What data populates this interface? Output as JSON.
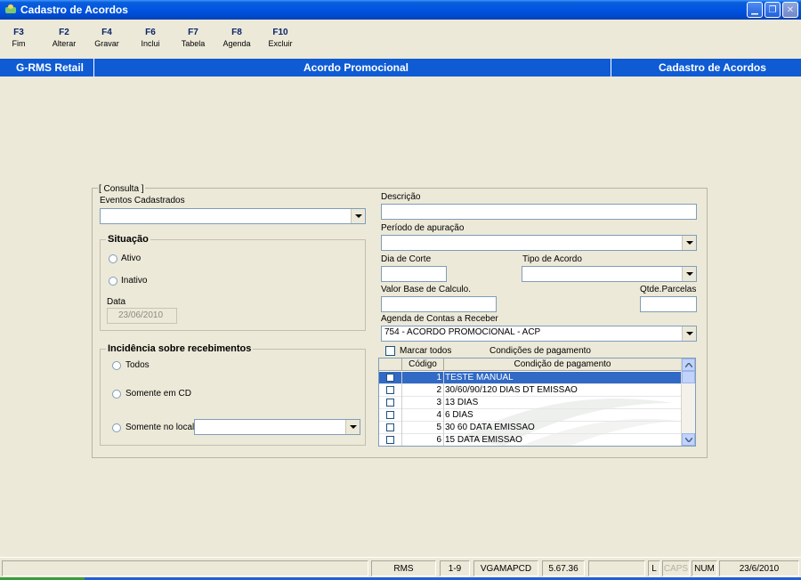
{
  "window": {
    "title": "Cadastro de Acordos"
  },
  "toolbar": {
    "keys": [
      {
        "key": "F3",
        "label": "Fim"
      },
      {
        "key": "F2",
        "label": "Alterar"
      },
      {
        "key": "F4",
        "label": "Gravar"
      },
      {
        "key": "F6",
        "label": "Inclui"
      },
      {
        "key": "F7",
        "label": "Tabela"
      },
      {
        "key": "F8",
        "label": "Agenda"
      },
      {
        "key": "F10",
        "label": "Excluir"
      }
    ]
  },
  "band": {
    "left": "G-RMS Retail",
    "center": "Acordo Promocional",
    "right": "Cadastro de Acordos"
  },
  "form": {
    "consulta_legend": "[ Consulta ]",
    "eventos_label": "Eventos Cadastrados",
    "eventos_value": "",
    "situacao_legend": "Situação",
    "ativo_label": "Ativo",
    "inativo_label": "Inativo",
    "data_label": "Data",
    "data_value": "23/06/2010",
    "incidencia_legend": "Incidência sobre recebimentos",
    "todos_label": "Todos",
    "somente_cd_label": "Somente em CD",
    "somente_local_label": "Somente no local",
    "somente_local_value": "",
    "descricao_label": "Descrição",
    "descricao_value": "",
    "periodo_label": "Período de apuração",
    "periodo_value": "",
    "dia_corte_label": "Dia de Corte",
    "dia_corte_value": "",
    "tipo_acordo_label": "Tipo de Acordo",
    "tipo_acordo_value": "",
    "valor_base_label": "Valor Base de Calculo.",
    "valor_base_value": "",
    "qtde_parcelas_label": "Qtde.Parcelas",
    "qtde_parcelas_value": "",
    "agenda_label": "Agenda de Contas a Receber",
    "agenda_value": "754 - ACORDO PROMOCIONAL - ACP",
    "marcar_todos_label": "Marcar todos",
    "condicoes_label": "Condições de pagamento"
  },
  "grid": {
    "headers": [
      "Código",
      "Condição de pagamento"
    ],
    "rows": [
      {
        "code": "1",
        "desc": "TESTE MANUAL",
        "selected": true
      },
      {
        "code": "2",
        "desc": "30/60/90/120 DIAS DT EMISSAO",
        "selected": false
      },
      {
        "code": "3",
        "desc": "13 DIAS",
        "selected": false
      },
      {
        "code": "4",
        "desc": "6 DIAS",
        "selected": false
      },
      {
        "code": "5",
        "desc": "30 60 DATA EMISSAO",
        "selected": false
      },
      {
        "code": "6",
        "desc": "15 DATA EMISSAO",
        "selected": false
      }
    ]
  },
  "status": {
    "cells": [
      "",
      "RMS",
      "1-9",
      "VGAMAPCD",
      "5.67.36",
      "",
      "L",
      "CAPS",
      "NUM",
      "23/6/2010"
    ]
  },
  "colors": {
    "title_blue": "#0054e3",
    "band_blue": "#0e5bd4",
    "selection": "#316ac5",
    "window_bg": "#ece9d8"
  }
}
